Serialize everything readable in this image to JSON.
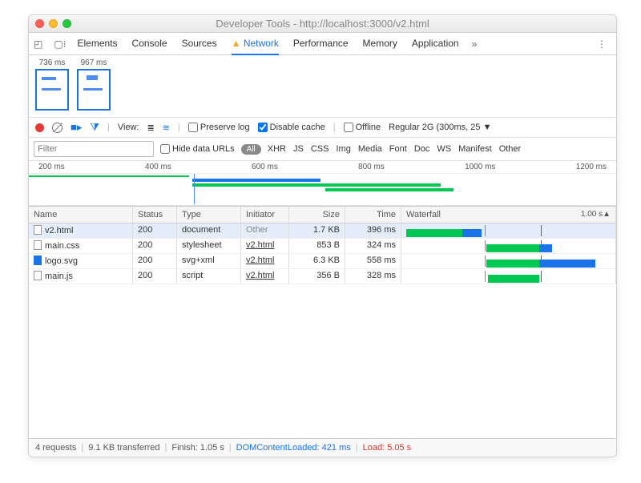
{
  "title": "Developer Tools - http://localhost:3000/v2.html",
  "tabs": {
    "elements": "Elements",
    "console": "Console",
    "sources": "Sources",
    "network": "Network",
    "performance": "Performance",
    "memory": "Memory",
    "application": "Application"
  },
  "filmstrip": {
    "t0": "736 ms",
    "t1": "967 ms"
  },
  "controls": {
    "view_label": "View:",
    "preserve_log": "Preserve log",
    "disable_cache": "Disable cache",
    "offline": "Offline",
    "throttle": "Regular 2G (300ms, 25"
  },
  "filter": {
    "placeholder": "Filter",
    "hide_data_urls": "Hide data URLs",
    "all": "All",
    "types": {
      "xhr": "XHR",
      "js": "JS",
      "css": "CSS",
      "img": "Img",
      "media": "Media",
      "font": "Font",
      "doc": "Doc",
      "ws": "WS",
      "manifest": "Manifest",
      "other": "Other"
    }
  },
  "ruler": {
    "t1": "200 ms",
    "t2": "400 ms",
    "t3": "600 ms",
    "t4": "800 ms",
    "t5": "1000 ms",
    "t6": "1200 ms"
  },
  "cols": {
    "name": "Name",
    "status": "Status",
    "type": "Type",
    "initiator": "Initiator",
    "size": "Size",
    "time": "Time",
    "waterfall": "Waterfall",
    "wfend": "1.00 s▲"
  },
  "rows": [
    {
      "name": "v2.html",
      "status": "200",
      "type": "document",
      "initiator": "Other",
      "size": "1.7 KB",
      "time": "396 ms"
    },
    {
      "name": "main.css",
      "status": "200",
      "type": "stylesheet",
      "initiator": "v2.html",
      "size": "853 B",
      "time": "324 ms"
    },
    {
      "name": "logo.svg",
      "status": "200",
      "type": "svg+xml",
      "initiator": "v2.html",
      "size": "6.3 KB",
      "time": "558 ms"
    },
    {
      "name": "main.js",
      "status": "200",
      "type": "script",
      "initiator": "v2.html",
      "size": "356 B",
      "time": "328 ms"
    }
  ],
  "status": {
    "requests": "4 requests",
    "transferred": "9.1 KB transferred",
    "finish": "Finish: 1.05 s",
    "dcl": "DOMContentLoaded: 421 ms",
    "load": "Load: 5.05 s"
  }
}
